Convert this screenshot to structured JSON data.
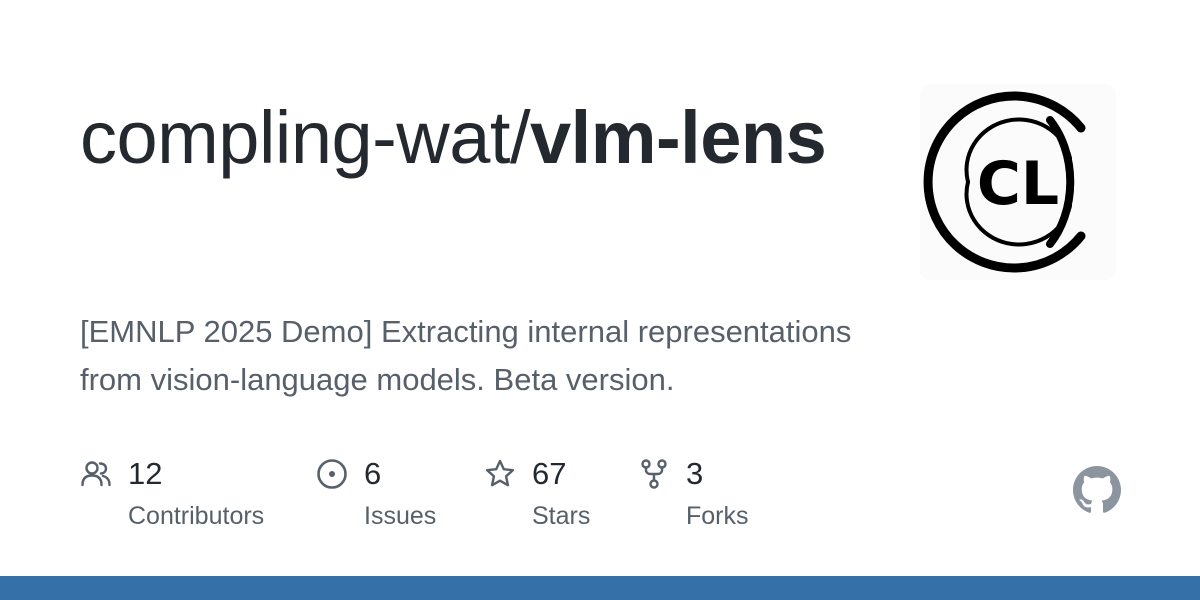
{
  "repo": {
    "owner": "compling-wat/",
    "name": "vlm-lens",
    "description": "[EMNLP 2025 Demo] Extracting internal representations from vision-language models. Beta version.",
    "logo_text": "CL"
  },
  "stats": [
    {
      "icon": "people-icon",
      "value": "12",
      "label": "Contributors"
    },
    {
      "icon": "issue-opened-icon",
      "value": "6",
      "label": "Issues"
    },
    {
      "icon": "star-icon",
      "value": "67",
      "label": "Stars"
    },
    {
      "icon": "repo-forked-icon",
      "value": "3",
      "label": "Forks"
    }
  ],
  "brand": {
    "icon": "github-mark-icon",
    "bar_color": "#3571a8",
    "icon_color": "#8c959f"
  }
}
